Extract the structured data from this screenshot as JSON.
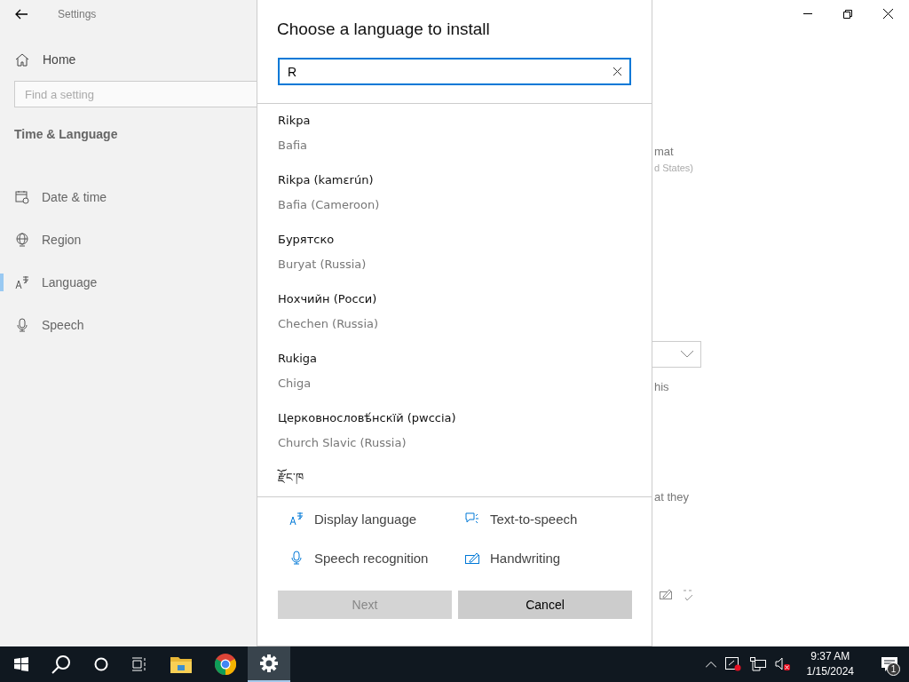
{
  "window": {
    "title": "Settings"
  },
  "sidebar": {
    "home": "Home",
    "search": {
      "placeholder": "Find a setting"
    },
    "section": "Time & Language",
    "items": [
      {
        "label": "Date & time",
        "kind": "calendar",
        "selected": false
      },
      {
        "label": "Region",
        "kind": "globe",
        "selected": false
      },
      {
        "label": "Language",
        "kind": "language",
        "selected": true
      },
      {
        "label": "Speech",
        "kind": "mic",
        "selected": false
      }
    ]
  },
  "background_texts": [
    {
      "text": "mat",
      "kind": "label"
    },
    {
      "text": "d States)",
      "kind": "sub"
    },
    {
      "text": "his",
      "kind": "label"
    },
    {
      "text": "at they",
      "kind": "label"
    }
  ],
  "dialog": {
    "title": "Choose a language to install",
    "search": {
      "value": "R"
    },
    "results": [
      {
        "name": "Rikpa",
        "region": "Bafia"
      },
      {
        "name": "Rikpa (kamɛrún)",
        "region": "Bafia (Cameroon)"
      },
      {
        "name": "Бурятско",
        "region": "Buryat (Russia)"
      },
      {
        "name": "Нохчийн (Росси)",
        "region": "Chechen (Russia)"
      },
      {
        "name": "Rukiga",
        "region": "Chiga"
      },
      {
        "name": "Церковнословѣ́нскїй (рwссіа)",
        "region": "Church Slavic (Russia)"
      },
      {
        "name": "རྫོང་ཁ"
      }
    ],
    "features": [
      {
        "label": "Display language",
        "kind": "language"
      },
      {
        "label": "Text-to-speech",
        "kind": "speech"
      },
      {
        "label": "Speech recognition",
        "kind": "mic"
      },
      {
        "label": "Handwriting",
        "kind": "pen"
      }
    ],
    "buttons": [
      {
        "label": "Next",
        "disabled": true
      },
      {
        "label": "Cancel",
        "disabled": false
      }
    ]
  },
  "taskbar": {
    "time": "9:37 AM",
    "date": "1/15/2024",
    "notifications": "1"
  }
}
